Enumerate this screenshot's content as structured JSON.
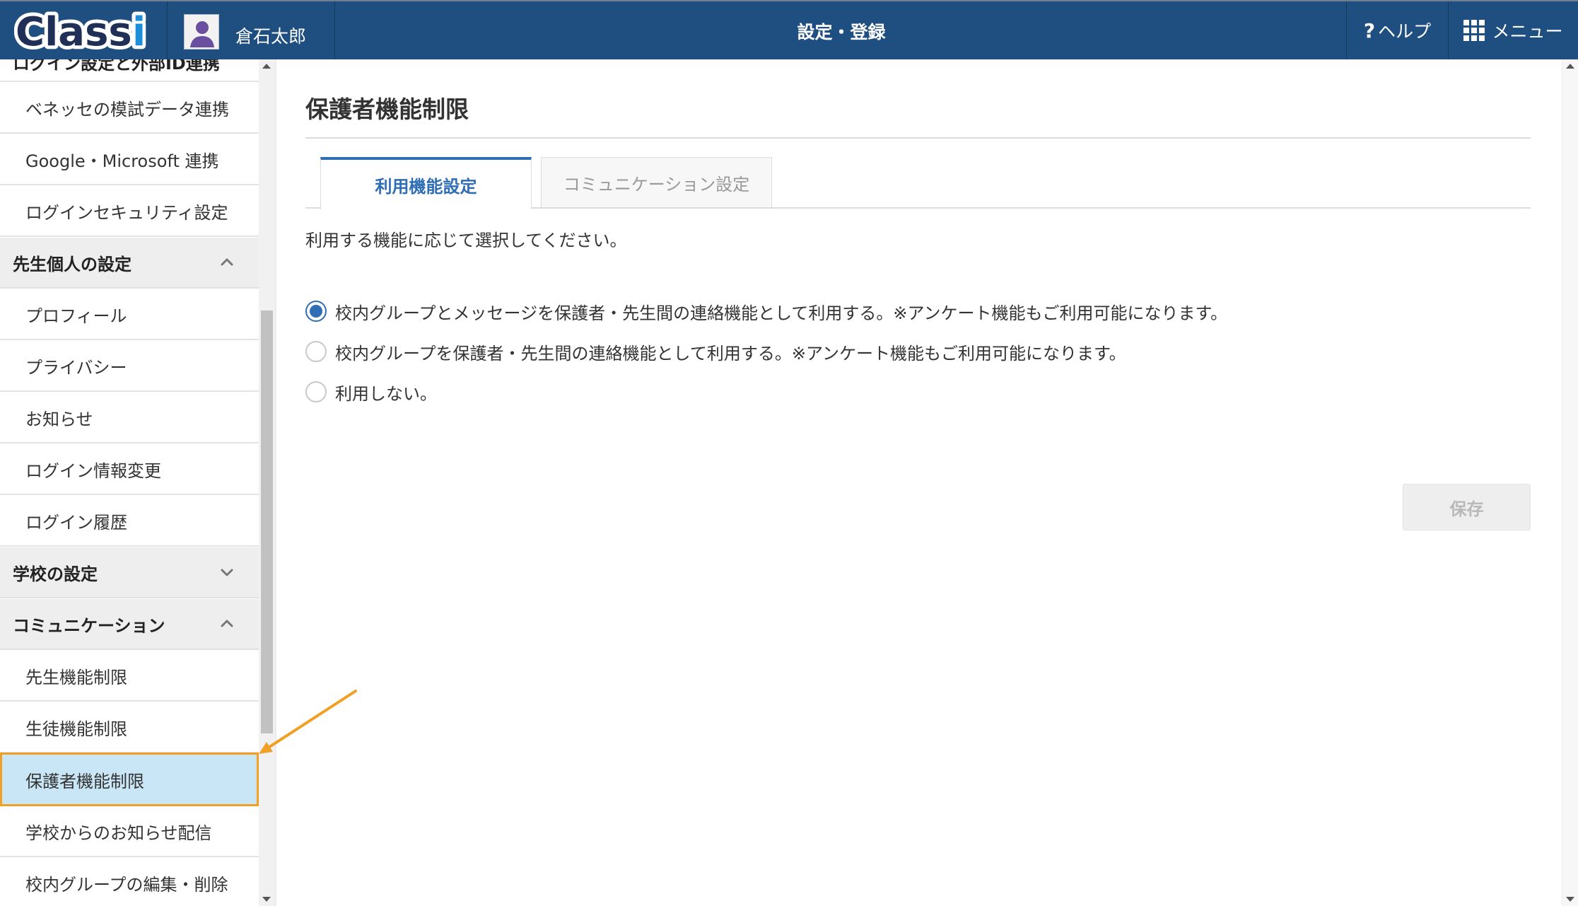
{
  "header": {
    "logo_text": "Classi",
    "user_name": "倉石太郎",
    "title": "設定・登録",
    "help_label": "ヘルプ",
    "menu_label": "メニュー"
  },
  "sidebar": {
    "partial_section": "ログイン設定と外部ID連携",
    "items": [
      {
        "label": "ベネッセの模試データ連携"
      },
      {
        "label": "Google・Microsoft 連携"
      },
      {
        "label": "ログインセキュリティ設定"
      }
    ],
    "section_personal": {
      "label": "先生個人の設定",
      "state": "expanded"
    },
    "personal_items": [
      {
        "label": "プロフィール"
      },
      {
        "label": "プライバシー"
      },
      {
        "label": "お知らせ"
      },
      {
        "label": "ログイン情報変更"
      },
      {
        "label": "ログイン履歴"
      }
    ],
    "section_school": {
      "label": "学校の設定",
      "state": "collapsed"
    },
    "section_comm": {
      "label": "コミュニケーション",
      "state": "expanded"
    },
    "comm_items": [
      {
        "label": "先生機能制限"
      },
      {
        "label": "生徒機能制限"
      },
      {
        "label": "保護者機能制限",
        "active": true
      },
      {
        "label": "学校からのお知らせ配信"
      },
      {
        "label": "校内グループの編集・削除"
      }
    ]
  },
  "main": {
    "page_title": "保護者機能制限",
    "tabs": [
      {
        "label": "利用機能設定",
        "active": true
      },
      {
        "label": "コミュニケーション設定",
        "active": false
      }
    ],
    "description": "利用する機能に応じて選択してください。",
    "options": [
      {
        "label": "校内グループとメッセージを保護者・先生間の連絡機能として利用する。※アンケート機能もご利用可能になります。",
        "checked": true
      },
      {
        "label": "校内グループを保護者・先生間の連絡機能として利用する。※アンケート機能もご利用可能になります。",
        "checked": false
      },
      {
        "label": "利用しない。",
        "checked": false
      }
    ],
    "save_label": "保存"
  },
  "colors": {
    "header_bg": "#1f4e80",
    "accent_blue": "#2f6db5",
    "active_item_bg": "#c8e6f5",
    "highlight_border": "#f0a024"
  }
}
